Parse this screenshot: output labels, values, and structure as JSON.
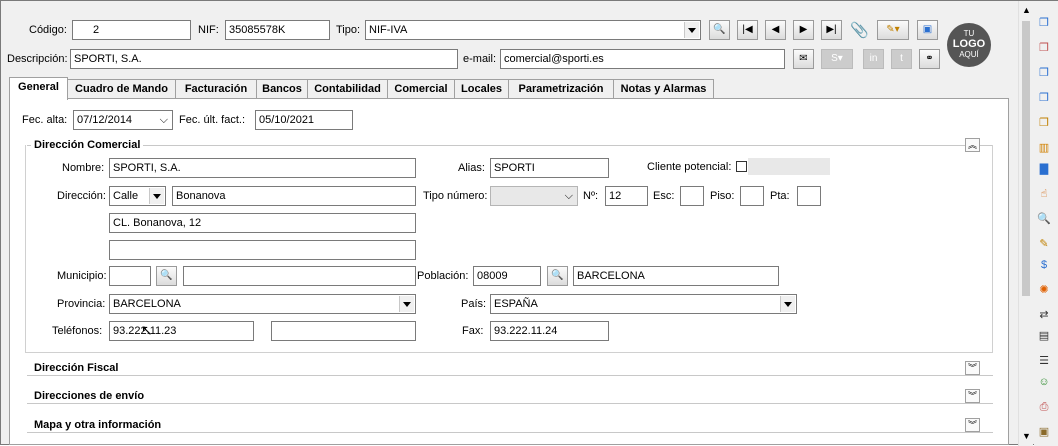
{
  "header": {
    "codigo_label": "Código:",
    "codigo_value": "2",
    "nif_label": "NIF:",
    "nif_value": "35085578K",
    "tipo_label": "Tipo:",
    "tipo_value": "NIF-IVA",
    "descripcion_label": "Descripción:",
    "descripcion_value": "SPORTI, S.A.",
    "email_label": "e-mail:",
    "email_value": "comercial@sporti.es",
    "logo_lines": [
      "TU",
      "LOGO",
      "AQUÍ"
    ]
  },
  "tabs": [
    {
      "label": "General",
      "active": true
    },
    {
      "label": "Cuadro de Mando"
    },
    {
      "label": "Facturación"
    },
    {
      "label": "Bancos"
    },
    {
      "label": "Contabilidad"
    },
    {
      "label": "Comercial"
    },
    {
      "label": "Locales"
    },
    {
      "label": "Parametrización"
    },
    {
      "label": "Notas y Alarmas"
    }
  ],
  "general": {
    "fec_alta_label": "Fec. alta:",
    "fec_alta_value": "07/12/2014",
    "fec_ult_label": "Fec. últ. fact.:",
    "fec_ult_value": "05/10/2021"
  },
  "direccion_comercial": {
    "title": "Dirección Comercial",
    "nombre_label": "Nombre:",
    "nombre_value": "SPORTI, S.A.",
    "alias_label": "Alias:",
    "alias_value": "SPORTI",
    "cliente_potencial_label": "Cliente potencial:",
    "direccion_label": "Dirección:",
    "via_value": "Calle",
    "calle_value": "Bonanova",
    "tipo_numero_label": "Tipo número:",
    "numero_label": "Nº:",
    "numero_value": "12",
    "esc_label": "Esc:",
    "piso_label": "Piso:",
    "pta_label": "Pta:",
    "linea2_value": "CL. Bonanova, 12",
    "linea3_value": "",
    "municipio_label": "Municipio:",
    "poblacion_label": "Población:",
    "cp_value": "08009",
    "poblacion_value": "BARCELONA",
    "provincia_label": "Provincia:",
    "provincia_value": "BARCELONA",
    "pais_label": "País:",
    "pais_value": "ESPAÑA",
    "telefonos_label": "Teléfonos:",
    "telefono1_value": "93.222.11.23",
    "fax_label": "Fax:",
    "fax_value": "93.222.11.24"
  },
  "sections": {
    "fiscal": "Dirección Fiscal",
    "envio": "Direcciones  de envío",
    "mapa": "Mapa y otra información"
  },
  "colors": {
    "accent_logo": "#555555",
    "panel_bg": "#ffffff",
    "window_bg": "#f0f0f0"
  }
}
